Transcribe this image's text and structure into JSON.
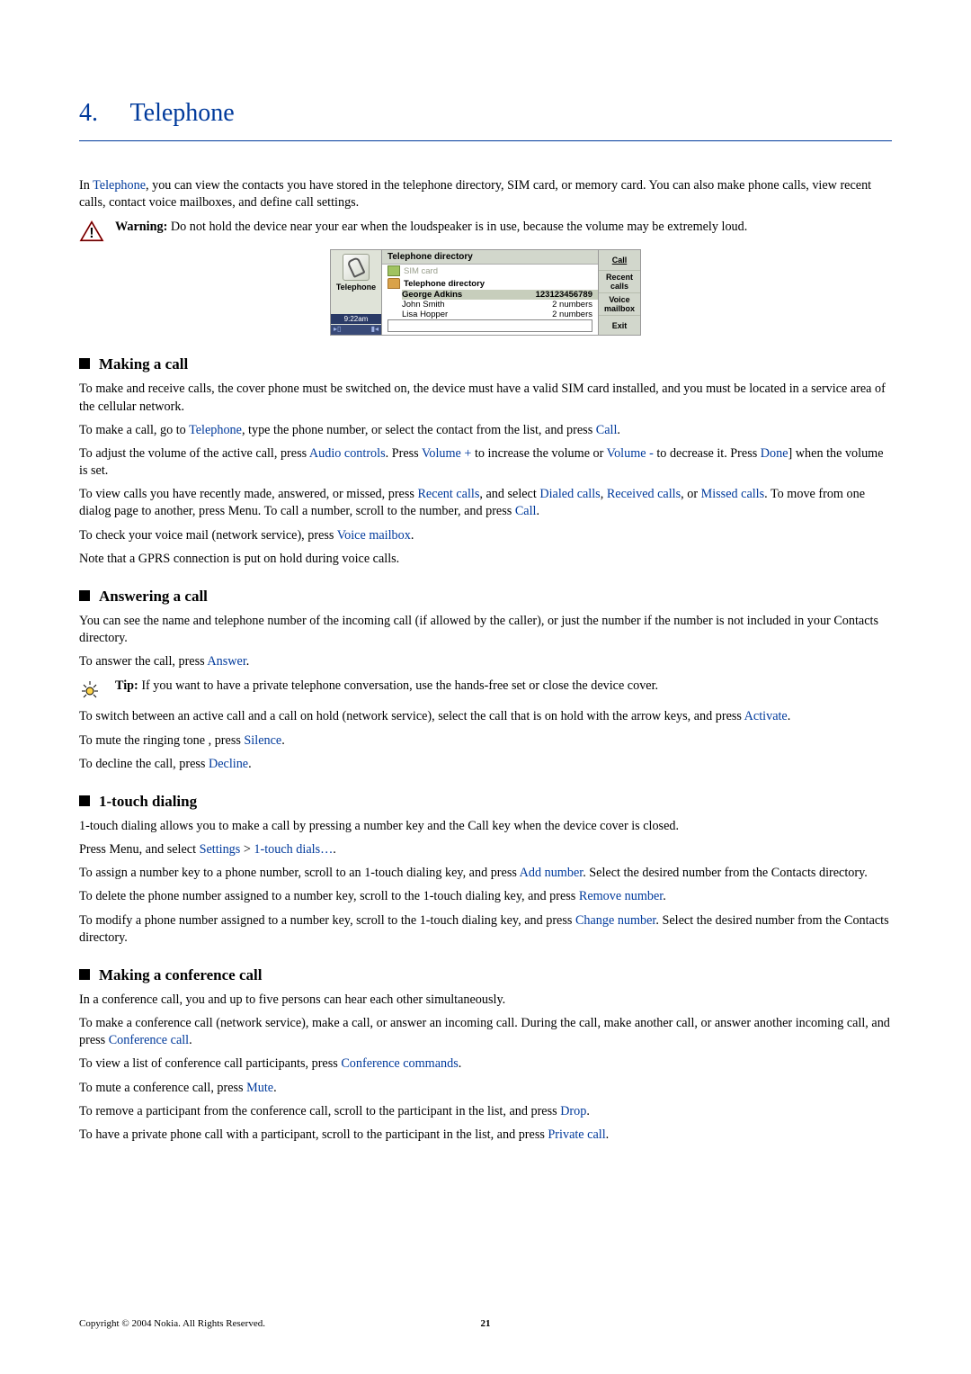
{
  "chapter": {
    "num": "4.",
    "title": "Telephone"
  },
  "intro": {
    "p1a": "In ",
    "p1_link": "Telephone",
    "p1b": ", you can view the contacts you have stored in the telephone directory, SIM card, or memory card. You can also make phone calls, view recent calls, contact voice mailboxes, and define call settings."
  },
  "warning": {
    "label": "Warning:",
    "text": " Do not hold the device near your ear when the loudspeaker is in use, because the volume may be extremely loud."
  },
  "device": {
    "left_label": "Telephone",
    "time": "9:22am",
    "header": "Telephone directory",
    "sim": "SIM card",
    "dir": "Telephone directory",
    "rows": [
      {
        "name": "George Adkins",
        "val": "123123456789"
      },
      {
        "name": "John Smith",
        "val": "2 numbers"
      },
      {
        "name": "Lisa Hopper",
        "val": "2 numbers"
      }
    ],
    "right": [
      "Call",
      "Recent calls",
      "Voice mailbox",
      "Exit"
    ]
  },
  "sections": {
    "make": {
      "title": "Making a call",
      "p1": "To make and receive calls, the cover phone must be switched on, the device must have a valid SIM card installed, and you must be located in a service area of the cellular network.",
      "p2a": "To make a call, go to ",
      "p2_link1": "Telephone",
      "p2b": ", type the phone number, or select the contact from the list, and press ",
      "p2_link2": "Call",
      "p2c": ".",
      "p3a": "To adjust the volume of the active call, press ",
      "p3_l1": "Audio controls",
      "p3b": ". Press ",
      "p3_l2": "Volume +",
      "p3c": " to increase the volume or ",
      "p3_l3": "Volume -",
      "p3d": " to decrease it. Press ",
      "p3_l4": "Done",
      "p3e": "] when the volume is set.",
      "p4a": "To view calls you have recently made, answered, or missed, press ",
      "p4_l1": "Recent calls",
      "p4b": ", and select ",
      "p4_l2": "Dialed calls",
      "p4c": ", ",
      "p4_l3": "Received calls",
      "p4d": ", or ",
      "p4_l4": "Missed calls",
      "p4e": ". To move from one dialog page to another, press Menu. To call a number, scroll to the number, and press ",
      "p4_l5": "Call",
      "p4f": ".",
      "p5a": "To check your voice mail (network service), press ",
      "p5_l1": "Voice mailbox",
      "p5b": ".",
      "p6": "Note that a GPRS connection is put on hold during voice calls."
    },
    "answer": {
      "title": "Answering a call",
      "p1": "You can see the name and telephone number of the incoming call (if allowed by the caller), or just the number if the number is not included in your Contacts directory.",
      "p2a": "To answer the call, press ",
      "p2_l1": "Answer",
      "p2b": ".",
      "tip_label": "Tip:",
      "tip_text": " If you want to have a private telephone conversation, use the hands-free set or close the device cover.",
      "p3a": "To switch between an active call and a call on hold (network service), select the call that is on hold with the arrow keys, and press ",
      "p3_l1": "Activate",
      "p3b": ".",
      "p4a": "To mute the ringing tone , press ",
      "p4_l1": "Silence",
      "p4b": ".",
      "p5a": "To decline the call, press ",
      "p5_l1": "Decline",
      "p5b": "."
    },
    "onetouch": {
      "title": "1-touch dialing",
      "p1": "1-touch dialing allows you to make a call by pressing a number key and the Call key when the device cover is closed.",
      "p2a": "Press Menu, and select ",
      "p2_l1": "Settings",
      "p2_gt": " > ",
      "p2_l2": "1-touch dials…",
      "p2b": ".",
      "p3a": "To assign a number key to a phone number, scroll to an 1-touch dialing key, and press ",
      "p3_l1": "Add number",
      "p3b": ". Select the desired number from the Contacts directory.",
      "p4a": "To delete the phone number assigned to a number key, scroll to the 1-touch dialing key, and press ",
      "p4_l1": "Remove number",
      "p4b": ".",
      "p5a": "To modify a phone number assigned to a number key, scroll to the 1-touch dialing key, and press ",
      "p5_l1": "Change number",
      "p5b": ". Select the desired number from the Contacts directory."
    },
    "conf": {
      "title": "Making a conference call",
      "p1": "In a conference call, you and up to five persons can hear each other simultaneously.",
      "p2a": "To make a conference call (network service), make a call, or answer an incoming call. During the call, make another call, or answer another incoming call, and press ",
      "p2_l1": "Conference call",
      "p2b": ".",
      "p3a": "To view a list of conference call participants, press ",
      "p3_l1": "Conference commands",
      "p3b": ".",
      "p4a": "To mute a conference call, press ",
      "p4_l1": "Mute",
      "p4b": ".",
      "p5a": "To remove a participant from the conference call, scroll to the participant in the list, and press ",
      "p5_l1": "Drop",
      "p5b": ".",
      "p6a": "To have a private phone call with a participant, scroll to the participant in the list, and press ",
      "p6_l1": "Private call",
      "p6b": "."
    }
  },
  "footer": {
    "copyright": "Copyright © 2004 Nokia. All Rights Reserved.",
    "page": "21"
  }
}
